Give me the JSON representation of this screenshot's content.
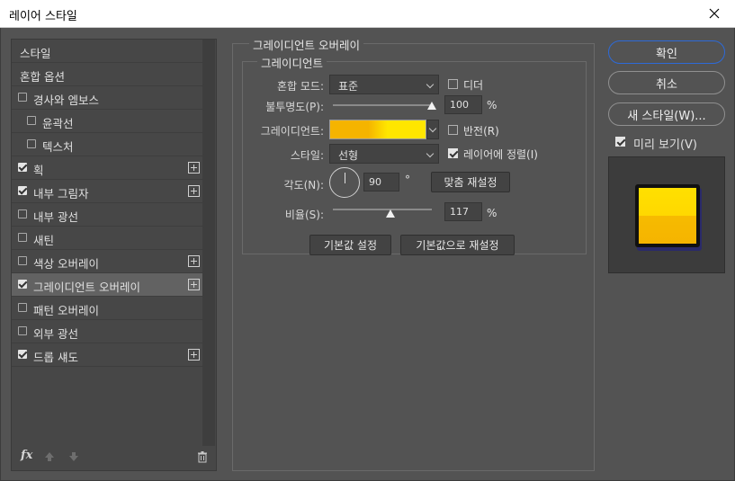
{
  "window": {
    "title": "레이어 스타일"
  },
  "sidebar": {
    "items": [
      {
        "label": "스타일",
        "checkbox": false,
        "checked": false,
        "plus": false,
        "selected": false,
        "indent": false
      },
      {
        "label": "혼합 옵션",
        "checkbox": false,
        "checked": false,
        "plus": false,
        "selected": false,
        "indent": false
      },
      {
        "label": "경사와 엠보스",
        "checkbox": true,
        "checked": false,
        "plus": false,
        "selected": false,
        "indent": false
      },
      {
        "label": "윤곽선",
        "checkbox": true,
        "checked": false,
        "plus": false,
        "selected": false,
        "indent": true
      },
      {
        "label": "텍스처",
        "checkbox": true,
        "checked": false,
        "plus": false,
        "selected": false,
        "indent": true
      },
      {
        "label": "획",
        "checkbox": true,
        "checked": true,
        "plus": true,
        "selected": false,
        "indent": false
      },
      {
        "label": "내부 그림자",
        "checkbox": true,
        "checked": true,
        "plus": true,
        "selected": false,
        "indent": false
      },
      {
        "label": "내부 광선",
        "checkbox": true,
        "checked": false,
        "plus": false,
        "selected": false,
        "indent": false
      },
      {
        "label": "새틴",
        "checkbox": true,
        "checked": false,
        "plus": false,
        "selected": false,
        "indent": false
      },
      {
        "label": "색상 오버레이",
        "checkbox": true,
        "checked": false,
        "plus": true,
        "selected": false,
        "indent": false
      },
      {
        "label": "그레이디언트 오버레이",
        "checkbox": true,
        "checked": true,
        "plus": true,
        "selected": true,
        "indent": false
      },
      {
        "label": "패턴 오버레이",
        "checkbox": true,
        "checked": false,
        "plus": false,
        "selected": false,
        "indent": false
      },
      {
        "label": "외부 광선",
        "checkbox": true,
        "checked": false,
        "plus": false,
        "selected": false,
        "indent": false
      },
      {
        "label": "드롭 섀도",
        "checkbox": true,
        "checked": true,
        "plus": true,
        "selected": false,
        "indent": false
      }
    ],
    "tools": {
      "fx_label": "fx"
    }
  },
  "main": {
    "group_title": "그레이디언트 오버레이",
    "subgroup_title": "그레이디언트",
    "blend_mode": {
      "label": "혼합 모드:",
      "value": "표준"
    },
    "dither": {
      "label": "디더",
      "checked": false
    },
    "opacity": {
      "label": "불투명도(P):",
      "value": "100",
      "unit": "%",
      "level": 1.0
    },
    "gradient": {
      "label": "그레이디언트:",
      "colors": [
        "#f5b400",
        "#ffe600"
      ]
    },
    "reverse": {
      "label": "반전(R)",
      "checked": false
    },
    "style": {
      "label": "스타일:",
      "value": "선형"
    },
    "align": {
      "label": "레이어에 정렬(I)",
      "checked": true
    },
    "angle": {
      "label": "각도(N):",
      "value": "90",
      "unit": "°",
      "reset_label": "맞춤 재설정"
    },
    "scale": {
      "label": "비율(S):",
      "value": "117",
      "unit": "%",
      "level": 0.585
    },
    "make_default_label": "기본값 설정",
    "reset_default_label": "기본값으로 재설정"
  },
  "actions": {
    "ok_label": "확인",
    "cancel_label": "취소",
    "new_style_label": "새 스타일(W)...",
    "preview": {
      "label": "미리 보기(V)",
      "checked": true
    }
  },
  "colors": {
    "accent_border": "#2d6ad8",
    "panel_bg": "#535353"
  }
}
